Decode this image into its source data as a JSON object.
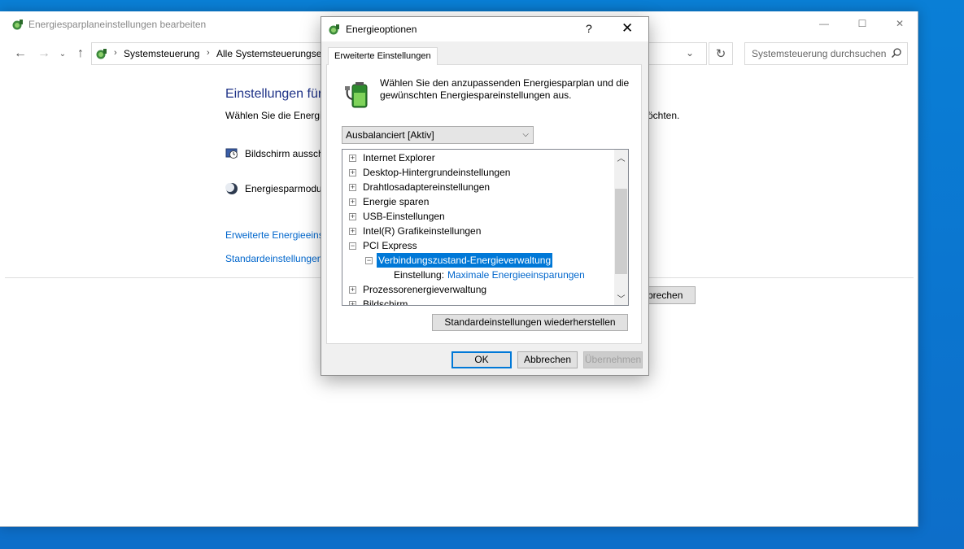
{
  "main_window": {
    "title": "Energiesparplaneinstellungen bearbeiten",
    "controls": {
      "minimize": "—",
      "maximize": "☐",
      "close": "✕"
    },
    "address": {
      "crumbs": [
        "Systemsteuerung",
        "Alle Systemsteuerungsel"
      ],
      "separator": "›"
    },
    "search_placeholder": "Systemsteuerung durchsuchen",
    "heading": "Einstellungen für",
    "description": "Wählen Sie die Energie",
    "description_tail": "öchten.",
    "settings": [
      {
        "label": "Bildschirm aussch",
        "icon": "display-timer-icon"
      },
      {
        "label": "Energiesparmodu",
        "icon": "sleep-moon-icon"
      }
    ],
    "links": {
      "advanced": "Erweiterte Energieeinst",
      "defaults": "Standardeinstellungen"
    },
    "partial_cancel_button": "brechen"
  },
  "dialog": {
    "title": "Energieoptionen",
    "help": "?",
    "close": "✕",
    "tab": "Erweiterte Einstellungen",
    "description": "Wählen Sie den anzupassenden Energiesparplan und die gewünschten Energiespareinstellungen aus.",
    "plan_selected": "Ausbalanciert [Aktiv]",
    "tree": {
      "items": [
        {
          "label": "Internet Explorer",
          "expander": "+"
        },
        {
          "label": "Desktop-Hintergrundeinstellungen",
          "expander": "+"
        },
        {
          "label": "Drahtlosadaptereinstellungen",
          "expander": "+"
        },
        {
          "label": "Energie sparen",
          "expander": "+"
        },
        {
          "label": "USB-Einstellungen",
          "expander": "+"
        },
        {
          "label": "Intel(R) Grafikeinstellungen",
          "expander": "+"
        },
        {
          "label": "PCI Express",
          "expander": "−"
        },
        {
          "label": "Verbindungszustand-Energieverwaltung",
          "expander": "−"
        },
        {
          "label": "Einstellung:",
          "value": "Maximale Energieeinsparungen"
        },
        {
          "label": "Prozessorenergieverwaltung",
          "expander": "+"
        },
        {
          "label": "Bildschirm",
          "expander": "+"
        }
      ],
      "selected": "Verbindungszustand-Energieverwaltung"
    },
    "restore_button": "Standardeinstellungen wiederherstellen",
    "buttons": {
      "ok": "OK",
      "cancel": "Abbrechen",
      "apply": "Übernehmen"
    }
  }
}
